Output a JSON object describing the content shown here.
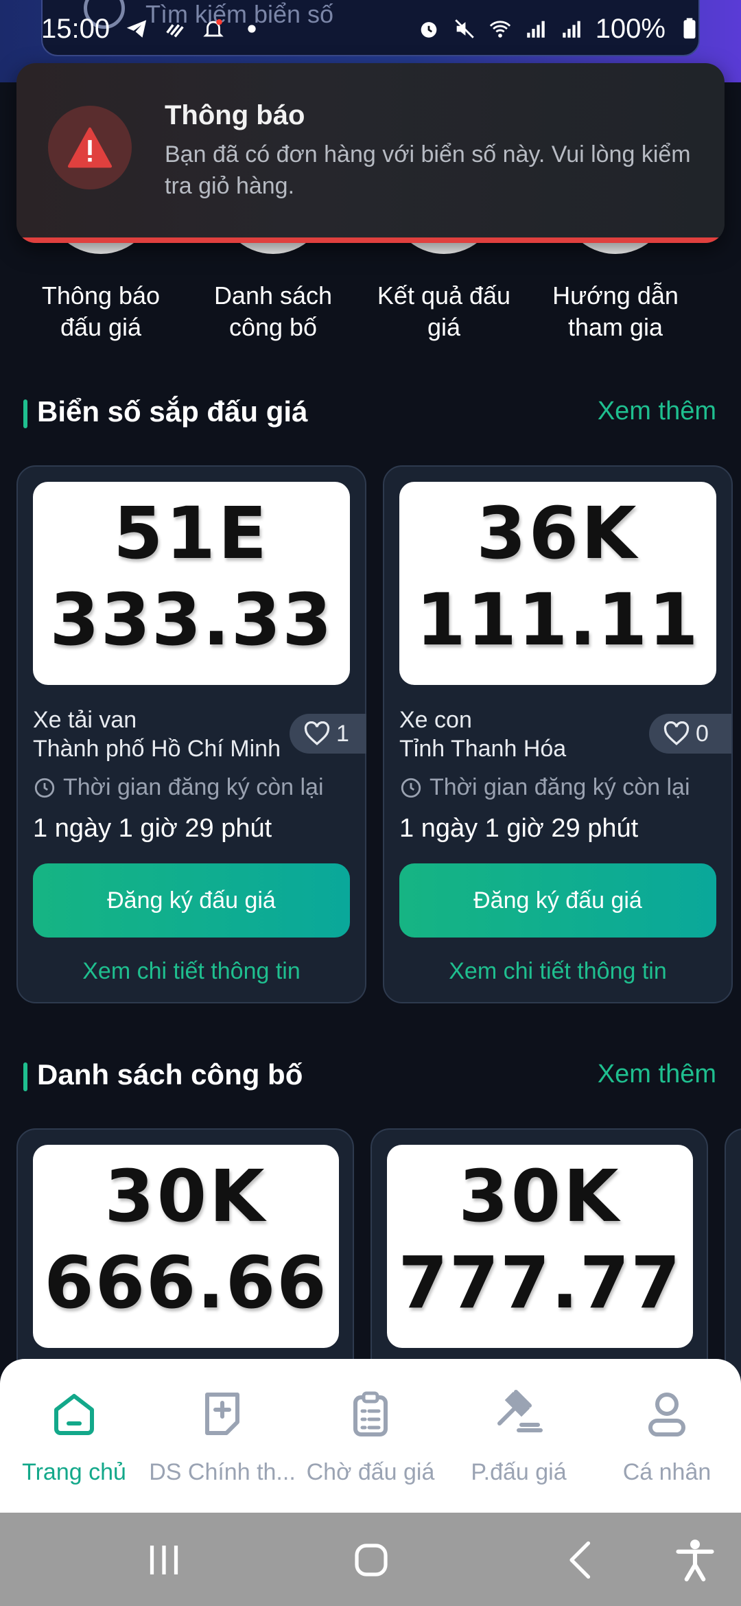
{
  "status_bar": {
    "time": "15:00",
    "battery": "100%"
  },
  "search": {
    "placeholder": "Tìm kiếm biển số"
  },
  "toast": {
    "title": "Thông báo",
    "message": "Bạn đã có đơn hàng với biển số này. Vui lòng kiểm tra giỏ hàng.",
    "icon": "warning-icon",
    "accent": "#e0403e"
  },
  "quick_menu": [
    {
      "label": "Thông báo\nđấu giá"
    },
    {
      "label": "Danh sách\ncông bố"
    },
    {
      "label": "Kết quả đấu\ngiá"
    },
    {
      "label": "Hướng dẫn\ntham gia"
    }
  ],
  "section_upcoming": {
    "title": "Biển số sắp đấu giá",
    "more": "Xem thêm"
  },
  "upcoming_cards": [
    {
      "plate_line1": "51E",
      "plate_line2": "333.33",
      "type": "Xe tải van",
      "location": "Thành phố Hồ Chí Minh",
      "likes": "1",
      "reg_label": "Thời gian đăng ký còn lại",
      "countdown": "1 ngày 1 giờ 29 phút",
      "button": "Đăng ký đấu giá",
      "detail": "Xem chi tiết thông tin"
    },
    {
      "plate_line1": "36K",
      "plate_line2": "111.11",
      "type": "Xe con",
      "location": "Tỉnh Thanh Hóa",
      "likes": "0",
      "reg_label": "Thời gian đăng ký còn lại",
      "countdown": "1 ngày 1 giờ 29 phút",
      "button": "Đăng ký đấu giá",
      "detail": "Xem chi tiết thông tin"
    }
  ],
  "section_published": {
    "title": "Danh sách công bố",
    "more": "Xem thêm"
  },
  "published_cards": [
    {
      "plate_line1": "30K",
      "plate_line2": "666.66"
    },
    {
      "plate_line1": "30K",
      "plate_line2": "777.77"
    }
  ],
  "bottom_nav": [
    {
      "label": "Trang chủ",
      "icon": "home-icon",
      "active": true
    },
    {
      "label": "DS Chính th...",
      "icon": "add-note-icon",
      "active": false
    },
    {
      "label": "Chờ đấu giá",
      "icon": "clipboard-list-icon",
      "active": false
    },
    {
      "label": "P.đấu giá",
      "icon": "gavel-icon",
      "active": false
    },
    {
      "label": "Cá nhân",
      "icon": "user-icon",
      "active": false
    }
  ],
  "colors": {
    "accent": "#1fbf8f",
    "background": "#0d111b",
    "card": "#1a2332"
  }
}
